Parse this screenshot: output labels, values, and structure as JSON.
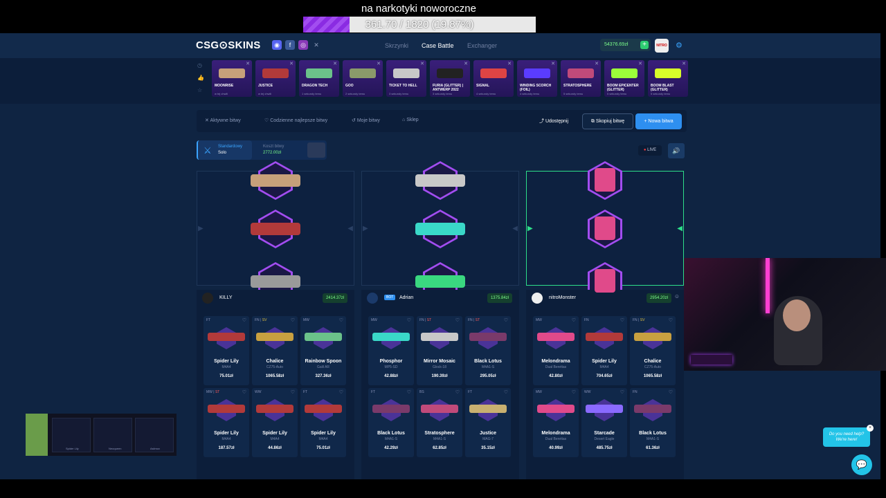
{
  "stream": {
    "goal_title": "na narkotyki noworoczne",
    "goal_text": "361.70 / 1820 (19.87%)",
    "goal_progress": 0.1987
  },
  "header": {
    "logo": "CSG⊙SKINS",
    "nav": [
      "Skrzynki",
      "Case Battle",
      "Exchanger"
    ],
    "balance": "54376.69zł",
    "avatar_text": "NITRO"
  },
  "drops": [
    {
      "name": "MOONRISE",
      "sub": "w tej chwili",
      "color": "#c6a07a"
    },
    {
      "name": "JUSTICE",
      "sub": "w tej chwili",
      "color": "#b23a3a"
    },
    {
      "name": "DRAGON TECH",
      "sub": "1 sekundy temu",
      "color": "#6bc28a"
    },
    {
      "name": "GOO",
      "sub": "2 sekundy temu",
      "color": "#8a9a6a"
    },
    {
      "name": "TICKET TO HELL",
      "sub": "3 sekundy temu",
      "color": "#c8c8c8"
    },
    {
      "name": "FURIA (GLITTER) | ANTWERP 2022",
      "sub": "3 sekundy temu",
      "color": "#222"
    },
    {
      "name": "SIGNAL",
      "sub": "4 sekundy temu",
      "color": "#d44"
    },
    {
      "name": "WINDING SCORCH (FOIL)",
      "sub": "4 sekundy temu",
      "color": "#5a3cff"
    },
    {
      "name": "STRATOSPHERE",
      "sub": "5 sekundy temu",
      "color": "#c04a7a"
    },
    {
      "name": "BOOM EPICENTER (GLITTER)",
      "sub": "5 sekundy temu",
      "color": "#9cff3a"
    },
    {
      "name": "BOOM BLAST (GLITTER)",
      "sub": "5 sekundy temu",
      "color": "#d8ff2a"
    }
  ],
  "tabs": {
    "active_battles": "Aktywne bitwy",
    "daily_best": "Codzienne najlepsze bitwy",
    "my_battles": "Moje bitwy",
    "shop": "Sklep",
    "share": "Udostępnij",
    "copy": "Skopiuj bitwę",
    "new": "+ Nowa bitwa"
  },
  "battle_info": {
    "mode": "Standardowy",
    "mode_sub": "Solo",
    "cost_label": "Koszt bitwy",
    "cost": "2772.00zł",
    "live": "LIVE"
  },
  "players": [
    {
      "name": "KILLY",
      "value": "2414.37zł",
      "bot": "",
      "items": [
        {
          "wear": "FT",
          "st": "",
          "name": "Spider Lily",
          "type": "M4A4",
          "price": "75.01zł",
          "color": "#b23a3a"
        },
        {
          "wear": "FN",
          "st": "SV",
          "name": "Chalice",
          "type": "CZ75-Auto",
          "price": "1065.58zł",
          "color": "#c8a040"
        },
        {
          "wear": "MW",
          "st": "",
          "name": "Rainbow Spoon",
          "type": "Galil AR",
          "price": "327.36zł",
          "color": "#6bc28a"
        },
        {
          "wear": "MW",
          "st": "ST",
          "name": "Spider Lily",
          "type": "M4A4",
          "price": "187.57zł",
          "color": "#b23a3a"
        },
        {
          "wear": "WW",
          "st": "",
          "name": "Spider Lily",
          "type": "M4A4",
          "price": "44.86zł",
          "color": "#b23a3a"
        },
        {
          "wear": "FT",
          "st": "",
          "name": "Spider Lily",
          "type": "M4A4",
          "price": "75.01zł",
          "color": "#b23a3a"
        }
      ]
    },
    {
      "name": "Adrian",
      "value": "1375.84zł",
      "bot": "BOT",
      "items": [
        {
          "wear": "MW",
          "st": "",
          "name": "Phosphor",
          "type": "MP5-SD",
          "price": "42.88zł",
          "color": "#3ad8c8"
        },
        {
          "wear": "FN",
          "st": "ST",
          "name": "Mirror Mosaic",
          "type": "Glock-18",
          "price": "190.39zł",
          "color": "#c8c8c8"
        },
        {
          "wear": "FN",
          "st": "ST",
          "name": "Black Lotus",
          "type": "M4A1-S",
          "price": "295.05zł",
          "color": "#7a3a6a"
        },
        {
          "wear": "FT",
          "st": "",
          "name": "Black Lotus",
          "type": "M4A1-S",
          "price": "42.29zł",
          "color": "#7a3a6a"
        },
        {
          "wear": "BS",
          "st": "",
          "name": "Stratosphere",
          "type": "M4A1-S",
          "price": "62.85zł",
          "color": "#c04a7a"
        },
        {
          "wear": "FT",
          "st": "",
          "name": "Justice",
          "type": "MAG-7",
          "price": "35.15zł",
          "color": "#c8b070"
        }
      ]
    },
    {
      "name": "nitroMonster",
      "value": "2954.20zł",
      "bot": "",
      "items": [
        {
          "wear": "MW",
          "st": "",
          "name": "Melondrama",
          "type": "Dual Berettas",
          "price": "42.80zł",
          "color": "#e04a8a"
        },
        {
          "wear": "FN",
          "st": "",
          "name": "Spider Lily",
          "type": "M4A4",
          "price": "704.65zł",
          "color": "#b23a3a"
        },
        {
          "wear": "FN",
          "st": "SV",
          "name": "Chalice",
          "type": "CZ75-Auto",
          "price": "1065.58zł",
          "color": "#c8a040"
        },
        {
          "wear": "MW",
          "st": "",
          "name": "Melondrama",
          "type": "Dual Berettas",
          "price": "40.99zł",
          "color": "#e04a8a"
        },
        {
          "wear": "WW",
          "st": "",
          "name": "Starcade",
          "type": "Desert Eagle",
          "price": "485.75zł",
          "color": "#8a6aff"
        },
        {
          "wear": "FN",
          "st": "",
          "name": "Black Lotus",
          "type": "M4A1-S",
          "price": "61.36zł",
          "color": "#7a3a6a"
        }
      ]
    }
  ],
  "recent": [
    "Spider Lily",
    "Neoqueen",
    "Asiimov"
  ],
  "help": {
    "line1": "Do you need help?",
    "line2": "We're here!"
  },
  "colors": {
    "accent": "#2e8ff0",
    "win": "#2ee08a",
    "bg": "#0f2442",
    "purple": "#a24df0"
  }
}
